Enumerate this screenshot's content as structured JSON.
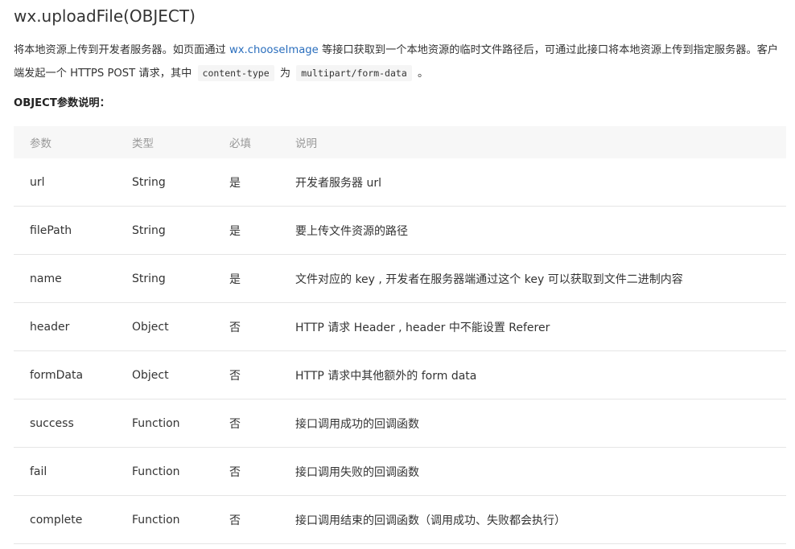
{
  "page": {
    "title": "wx.uploadFile(OBJECT)"
  },
  "description": {
    "part1": "将本地资源上传到开发者服务器。如页面通过 ",
    "link_text": "wx.chooseImage",
    "part2": " 等接口获取到一个本地资源的临时文件路径后，可通过此接口将本地资源上传到指定服务器。客户端发起一个 HTTPS POST 请求，其中 ",
    "code1": "content-type",
    "part3": " 为 ",
    "code2": "multipart/form-data",
    "part4": " 。"
  },
  "section": {
    "heading": "OBJECT参数说明："
  },
  "table": {
    "headers": [
      "参数",
      "类型",
      "必填",
      "说明"
    ],
    "rows": [
      [
        "url",
        "String",
        "是",
        "开发者服务器 url"
      ],
      [
        "filePath",
        "String",
        "是",
        "要上传文件资源的路径"
      ],
      [
        "name",
        "String",
        "是",
        "文件对应的 key , 开发者在服务器端通过这个 key 可以获取到文件二进制内容"
      ],
      [
        "header",
        "Object",
        "否",
        "HTTP 请求 Header , header 中不能设置 Referer"
      ],
      [
        "formData",
        "Object",
        "否",
        "HTTP 请求中其他额外的 form data"
      ],
      [
        "success",
        "Function",
        "否",
        "接口调用成功的回调函数"
      ],
      [
        "fail",
        "Function",
        "否",
        "接口调用失败的回调函数"
      ],
      [
        "complete",
        "Function",
        "否",
        "接口调用结束的回调函数（调用成功、失败都会执行）"
      ]
    ]
  },
  "colors": {
    "link": "#2a6ebd",
    "header_bg": "#f7f7f7",
    "header_text": "#999999",
    "body_text": "#333333",
    "row_border": "#e5e5e5"
  }
}
